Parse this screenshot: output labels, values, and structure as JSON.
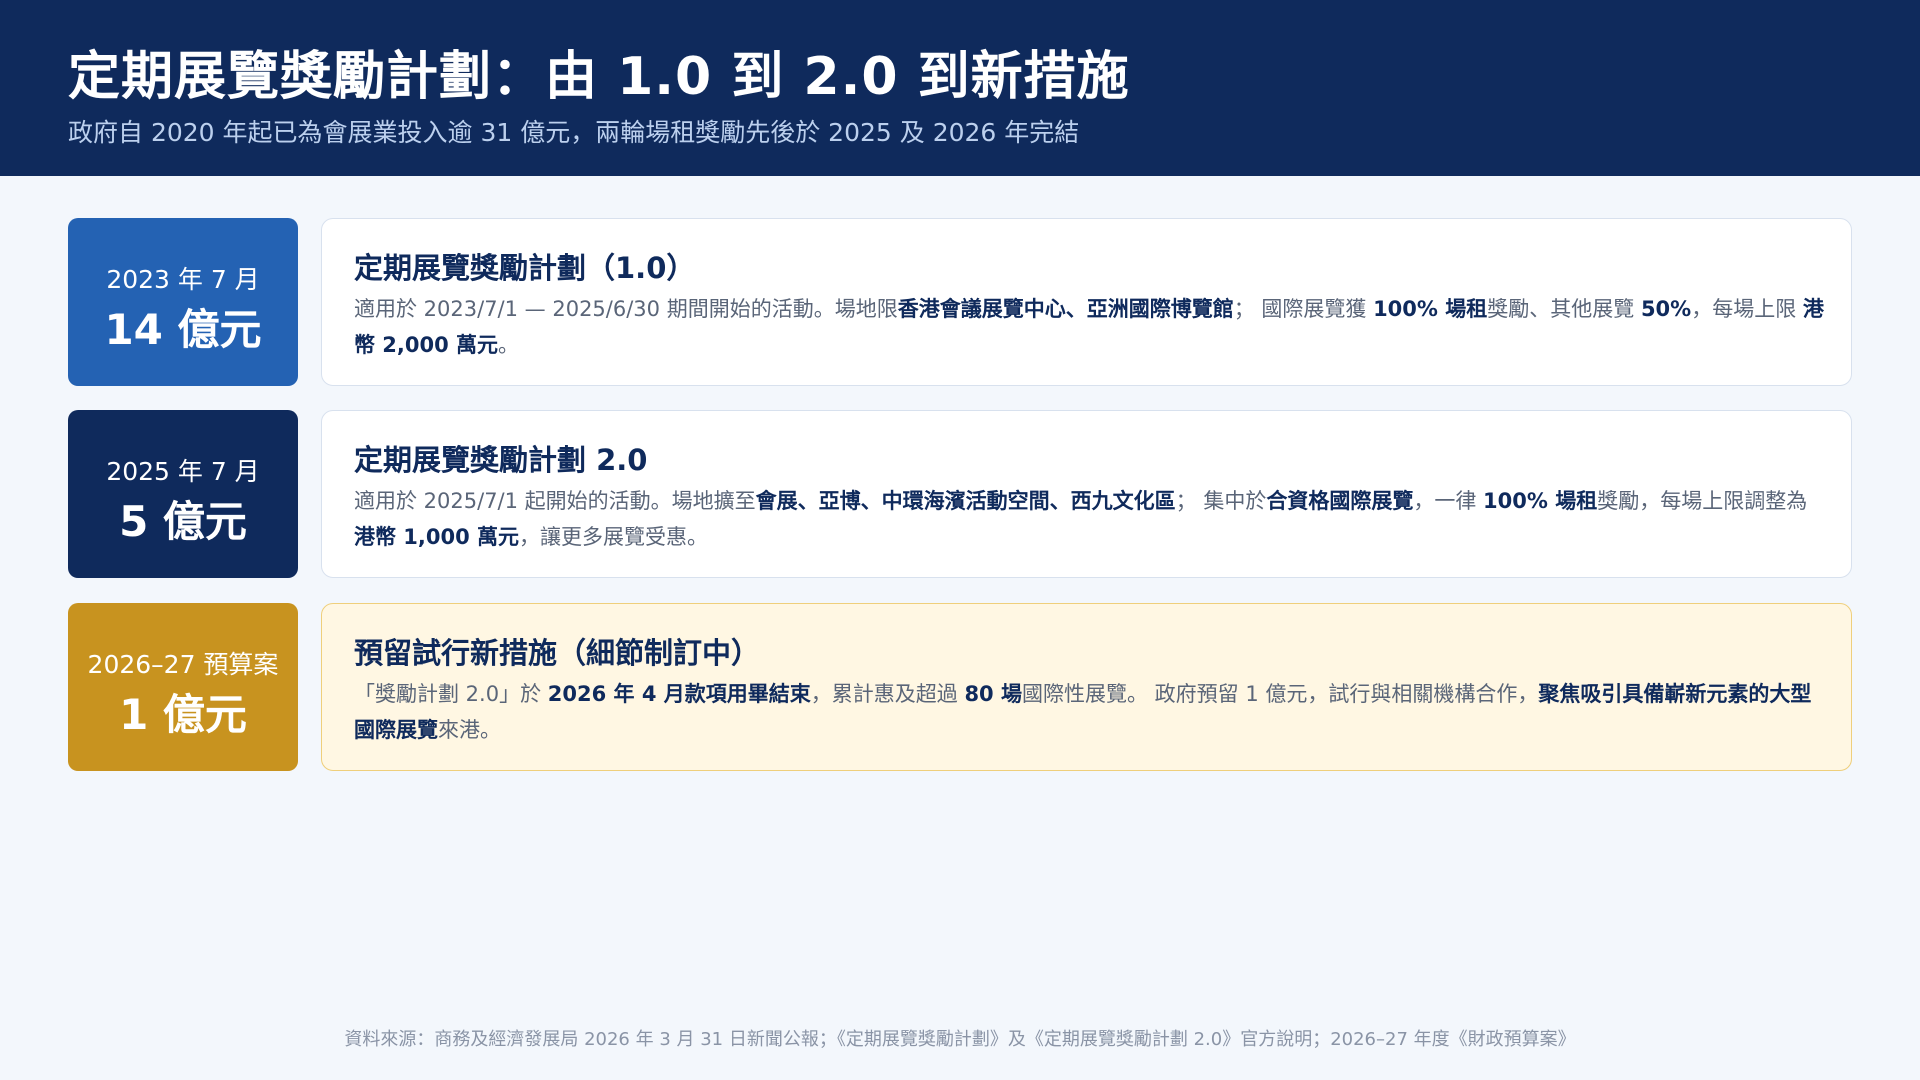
{
  "header": {
    "title": "定期展覽獎勵計劃：由 1.0 到 2.0 到新措施",
    "subtitle": "政府自 2020 年起已為會展業投入逾 31 億元，兩輪場租獎勵先後於 2025 及 2026 年完結"
  },
  "timeline": [
    {
      "date": "2023 年 7 月",
      "amount": "14 億元",
      "title": "定期展覽獎勵計劃（1.0）",
      "body": [
        {
          "t": "適用於 2023/7/1 — 2025/6/30 期間開始的活動。場地限"
        },
        {
          "t": "香港會議展覽中心、亞洲國際博覽館",
          "b": true
        },
        {
          "t": "； 國際展覽獲 "
        },
        {
          "t": "100% 場租",
          "b": true
        },
        {
          "t": "獎勵、其他展覽 "
        },
        {
          "t": "50%",
          "b": true
        },
        {
          "t": "，每場上限 "
        },
        {
          "t": "港幣 2,000 萬元",
          "b": true
        },
        {
          "t": "。"
        }
      ]
    },
    {
      "date": "2025 年 7 月",
      "amount": "5 億元",
      "title": "定期展覽獎勵計劃 2.0",
      "body": [
        {
          "t": "適用於 2025/7/1 起開始的活動。場地擴至"
        },
        {
          "t": "會展、亞博、中環海濱活動空間、西九文化區",
          "b": true
        },
        {
          "t": "； 集中於"
        },
        {
          "t": "合資格國際展覽",
          "b": true
        },
        {
          "t": "，一律 "
        },
        {
          "t": "100% 場租",
          "b": true
        },
        {
          "t": "獎勵，每場上限調整為 "
        },
        {
          "t": "港幣 1,000 萬元",
          "b": true
        },
        {
          "t": "，讓更多展覽受惠。"
        }
      ]
    },
    {
      "date": "2026–27 預算案",
      "amount": "1 億元",
      "title": "預留試行新措施（細節制訂中）",
      "body": [
        {
          "t": "「獎勵計劃 2.0」於 "
        },
        {
          "t": "2026 年 4 月款項用畢結束",
          "b": true
        },
        {
          "t": "，累計惠及超過 "
        },
        {
          "t": "80 場",
          "b": true
        },
        {
          "t": "國際性展覽。 政府預留 1 億元，試行與相關機構合作，"
        },
        {
          "t": "聚焦吸引具備嶄新元素的大型國際展覽",
          "b": true
        },
        {
          "t": "來港。"
        }
      ]
    }
  ],
  "source": "資料來源：商務及經濟發展局 2026 年 3 月 31 日新聞公報；《定期展覽獎勵計劃》及《定期展覽獎勵計劃 2.0》官方說明；2026–27 年度《財政預算案》",
  "colors": {
    "header_bg": "#0f2a5c",
    "badge_2023": "#2462b3",
    "badge_2025": "#0f2a5c",
    "badge_2026": "#c8931f",
    "highlight_card_bg": "#fff7e3"
  }
}
